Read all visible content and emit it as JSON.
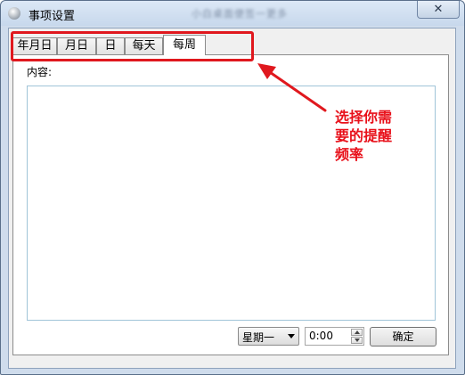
{
  "window": {
    "title": "事项设置",
    "title_obscured": "小白桌面便签一更多",
    "close_glyph": "✕"
  },
  "tabs": [
    {
      "label": "年月日",
      "active": false
    },
    {
      "label": "月日",
      "active": false
    },
    {
      "label": "日",
      "active": false
    },
    {
      "label": "每天",
      "active": false
    },
    {
      "label": "每周",
      "active": true
    }
  ],
  "content": {
    "label": "内容:",
    "value": ""
  },
  "footer": {
    "weekday_value": "星期一",
    "time_value": "0:00",
    "ok_label": "确定"
  },
  "annotation": {
    "text": "选择你需要的提醒频率",
    "color": "#e0181e"
  },
  "icons": {
    "app": "app-icon",
    "close": "close-icon",
    "dropdown": "chevron-down-icon",
    "spin_up": "spin-up-icon",
    "spin_down": "spin-down-icon"
  }
}
